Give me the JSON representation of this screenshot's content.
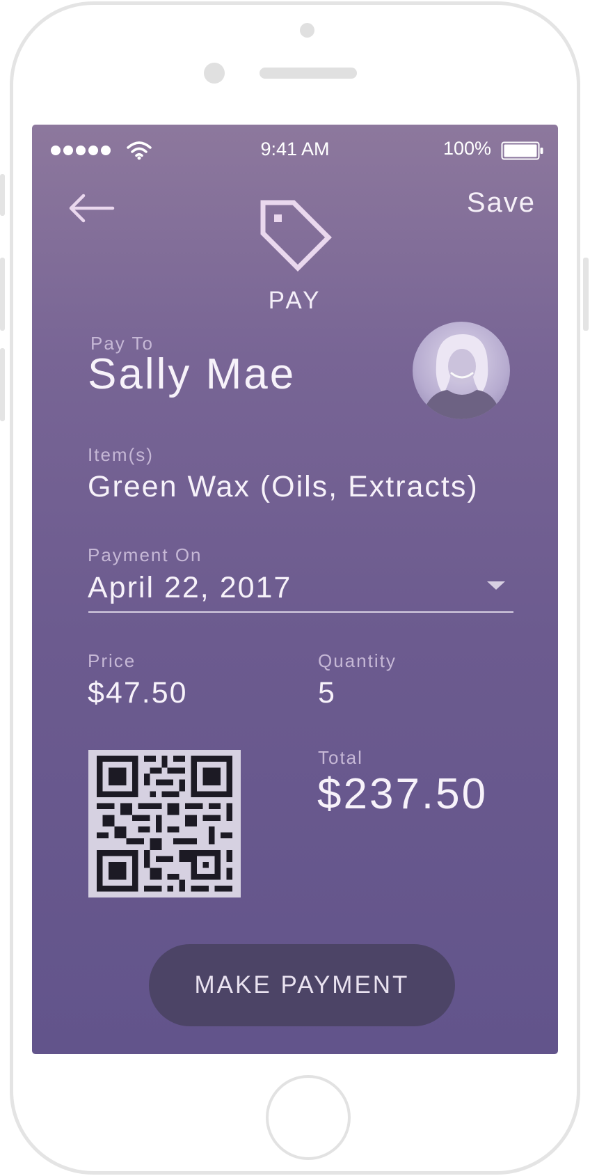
{
  "status_bar": {
    "time": "9:41 AM",
    "battery": "100%",
    "icons": [
      "signal-dots-icon",
      "wifi-icon",
      "battery-icon"
    ]
  },
  "nav": {
    "back_icon": "arrow-left-icon",
    "save_label": "Save",
    "header_icon": "price-tag-icon",
    "title": "PAY"
  },
  "payee": {
    "label": "Pay To",
    "name": "Sally Mae",
    "avatar_icon": "payee-avatar"
  },
  "items": {
    "label": "Item(s)",
    "value": "Green Wax (Oils, Extracts)"
  },
  "payment_date": {
    "label": "Payment On",
    "value": "April 22, 2017",
    "dropdown_icon": "caret-down-icon"
  },
  "price": {
    "label": "Price",
    "value": "$47.50"
  },
  "quantity": {
    "label": "Quantity",
    "value": "5"
  },
  "total": {
    "label": "Total",
    "value": "$237.50"
  },
  "qr_code_icon": "qr-code",
  "action": {
    "label": "MAKE PAYMENT"
  },
  "colors": {
    "gradient_top": "#8d789d",
    "gradient_bottom": "#62548b",
    "button": "#4c4466",
    "text": "#f4eef8",
    "label": "#c6b8d6"
  }
}
